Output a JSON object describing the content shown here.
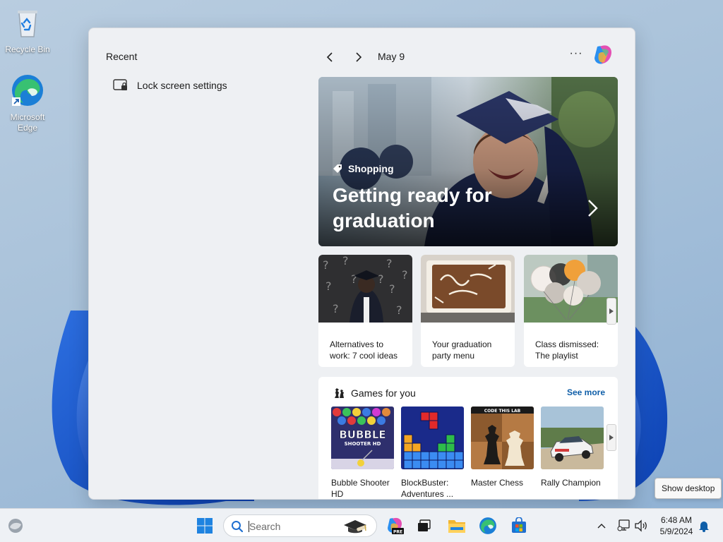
{
  "desktop": {
    "recycle_bin_label": "Recycle Bin",
    "edge_label": "Microsoft Edge"
  },
  "widgets": {
    "recent_title": "Recent",
    "recent_items": [
      {
        "label": "Lock screen settings",
        "icon": "lock-screen-icon"
      }
    ],
    "date": "May 9",
    "more_label": "···",
    "hero": {
      "tag": "Shopping",
      "title": "Getting ready for graduation"
    },
    "cards": [
      {
        "caption": "Alternatives to work: 7 cool ideas"
      },
      {
        "caption": "Your graduation party menu"
      },
      {
        "caption": "Class dismissed: The playlist"
      }
    ],
    "games": {
      "title": "Games for you",
      "see_more": "See more",
      "items": [
        {
          "name": "Bubble Shooter HD",
          "thumb_text": "BUBBLE",
          "thumb_sub": "SHOOTER HD"
        },
        {
          "name": "BlockBuster: Adventures ..."
        },
        {
          "name": "Master Chess",
          "thumb_text": "CODE THIS LAB"
        },
        {
          "name": "Rally Champion"
        }
      ]
    }
  },
  "tooltip": {
    "show_desktop": "Show desktop"
  },
  "taskbar": {
    "search_placeholder": "Search",
    "clock_time": "6:48 AM",
    "clock_date": "5/9/2024",
    "copilot_badge": "PRE"
  },
  "colors": {
    "accent": "#0f5ea8",
    "panel_bg": "#eef0f3",
    "taskbar_bg": "#eef1f5"
  }
}
